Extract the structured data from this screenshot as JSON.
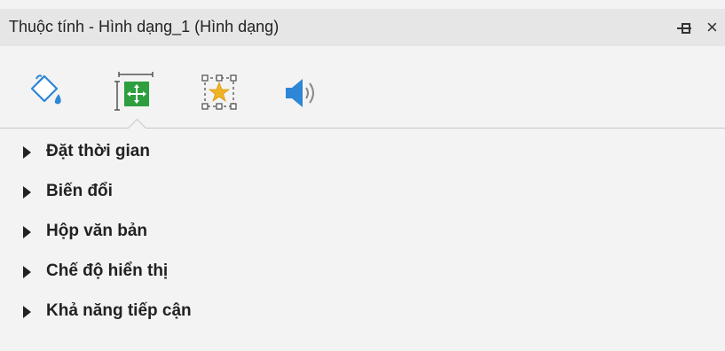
{
  "window": {
    "title": "Thuộc tính - Hình dạng_1 (Hình dạng)",
    "pin_icon": "pin-icon",
    "close_label": "×"
  },
  "tabs": [
    {
      "id": "fill",
      "icon": "paint-bucket-icon",
      "active": false
    },
    {
      "id": "size-position",
      "icon": "size-position-icon",
      "active": true
    },
    {
      "id": "effects",
      "icon": "star-selection-icon",
      "active": false
    },
    {
      "id": "audio",
      "icon": "speaker-icon",
      "active": false
    }
  ],
  "colors": {
    "accent_green": "#2e9e3e",
    "accent_blue": "#2e86d6",
    "accent_gold": "#f0b323"
  },
  "sections": [
    {
      "label": "Đặt thời gian"
    },
    {
      "label": "Biến đổi"
    },
    {
      "label": "Hộp văn bản"
    },
    {
      "label": "Chế độ hiển thị"
    },
    {
      "label": "Khả năng tiếp cận"
    }
  ]
}
